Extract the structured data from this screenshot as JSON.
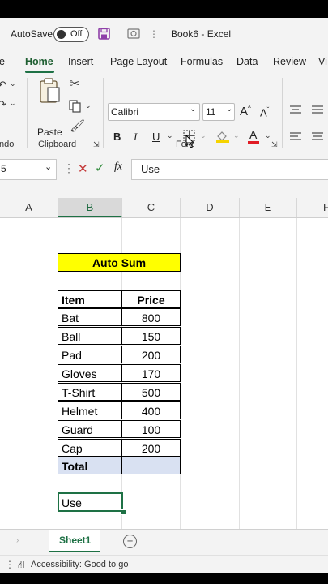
{
  "titlebar": {
    "autosave_label": "AutoSave",
    "autosave_state": "Off",
    "document_title": "Book6  -  Excel"
  },
  "tabs": {
    "cut_left": "e",
    "home": "Home",
    "insert": "Insert",
    "page_layout": "Page Layout",
    "formulas": "Formulas",
    "data": "Data",
    "review": "Review",
    "view_cut": "Vi"
  },
  "ribbon": {
    "undo_group": "ndo",
    "paste_label": "Paste",
    "clipboard_group": "Clipboard",
    "font_name": "Calibri",
    "font_size": "11",
    "bold": "B",
    "italic": "I",
    "underline": "U",
    "grow": "A",
    "shrink": "A",
    "font_color": "A",
    "font_group": "Font",
    "accent_color": "#1e7145",
    "font_color_bar": "#e01b24"
  },
  "formula_bar": {
    "namebox_value": "5",
    "cancel": "✕",
    "enter": "✓",
    "fx": "fx",
    "content": "Use"
  },
  "columns": [
    "A",
    "B",
    "C",
    "D",
    "E",
    "F"
  ],
  "sheet": {
    "title": "Auto Sum",
    "title_bg": "#ffff00",
    "header_item": "Item",
    "header_price": "Price",
    "rows": [
      {
        "item": "Bat",
        "price": "800"
      },
      {
        "item": "Ball",
        "price": "150"
      },
      {
        "item": "Pad",
        "price": "200"
      },
      {
        "item": "Gloves",
        "price": "170"
      },
      {
        "item": "T-Shirt",
        "price": "500"
      },
      {
        "item": "Helmet",
        "price": "400"
      },
      {
        "item": "Guard",
        "price": "100"
      },
      {
        "item": "Cap",
        "price": "200"
      }
    ],
    "total_label": "Total",
    "total_value": "",
    "total_bg": "#d9e1f2",
    "active_cell_text": "Use"
  },
  "sheet_tabs": {
    "active": "Sheet1",
    "add": "+"
  },
  "statusbar": {
    "accessibility": "Accessibility: Good to go"
  }
}
